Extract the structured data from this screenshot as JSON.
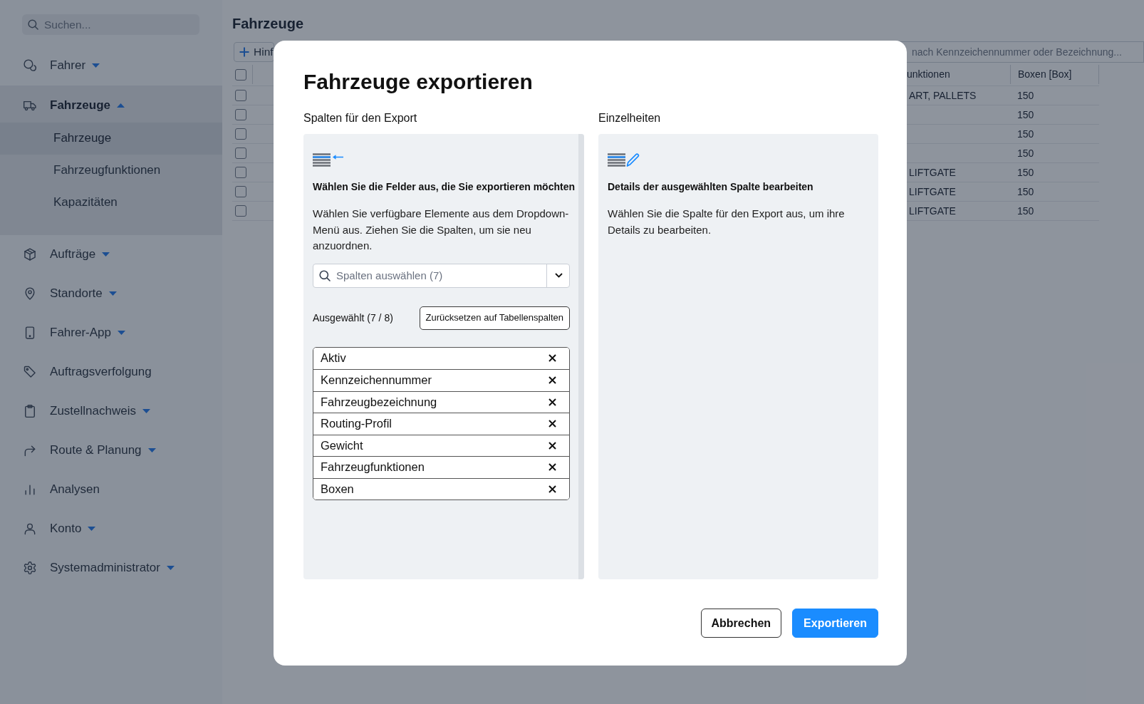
{
  "sidebar": {
    "search": {
      "placeholder": "Suchen..."
    },
    "items": [
      {
        "label": "Fahrer",
        "kind": "group",
        "expanded": false
      },
      {
        "label": "Fahrzeuge",
        "kind": "group",
        "expanded": true,
        "children": [
          {
            "label": "Fahrzeuge",
            "selected": true
          },
          {
            "label": "Fahrzeugfunktionen",
            "selected": false
          },
          {
            "label": "Kapazitäten",
            "selected": false
          }
        ]
      },
      {
        "label": "Aufträge",
        "kind": "group",
        "expanded": false
      },
      {
        "label": "Standorte",
        "kind": "group",
        "expanded": false
      },
      {
        "label": "Fahrer-App",
        "kind": "group",
        "expanded": false
      },
      {
        "label": "Auftragsverfolgung",
        "kind": "link"
      },
      {
        "label": "Zustellnachweis",
        "kind": "group",
        "expanded": false
      },
      {
        "label": "Route & Planung",
        "kind": "group",
        "expanded": false
      },
      {
        "label": "Analysen",
        "kind": "link"
      },
      {
        "label": "Konto",
        "kind": "group",
        "expanded": false
      },
      {
        "label": "Systemadministrator",
        "kind": "group",
        "expanded": false
      }
    ]
  },
  "page": {
    "title": "Fahrzeuge",
    "add_button": {
      "label": "Hinf"
    },
    "search": {
      "placeholder": "nach Kennzeichennummer oder Bezeichnung..."
    },
    "table": {
      "select_all": {
        "checked": false
      },
      "columns": [
        "unktionen",
        "Boxen [Box]"
      ],
      "rows": [
        {
          "checked": false,
          "column_1": "ART, PALLETS",
          "column_2": "150"
        },
        {
          "checked": false,
          "column_2": "150"
        },
        {
          "checked": false,
          "column_2": "150"
        },
        {
          "checked": false,
          "column_2": "150"
        },
        {
          "checked": false,
          "column_1": "LIFTGATE",
          "column_2": "150"
        },
        {
          "checked": false,
          "column_1": "LIFTGATE",
          "column_2": "150"
        },
        {
          "checked": false,
          "column_1": "LIFTGATE",
          "column_2": "150"
        }
      ]
    }
  },
  "dialog": {
    "title": "Fahrzeuge exportieren",
    "columns_panel": {
      "heading": "Spalten für den Export",
      "title": "Wählen Sie die Felder aus, die Sie exportieren möchten",
      "description": "Wählen Sie verfügbare Elemente aus dem Dropdown-Menü aus. Ziehen Sie die Spalten, um sie neu anzuordnen.",
      "select": {
        "placeholder": "Spalten auswählen (7)"
      },
      "selected_count": "Ausgewählt (7 / 8)",
      "reset_button": "Zurücksetzen auf Tabellenspalten",
      "selected_columns": [
        "Aktiv",
        "Kennzeichennummer",
        "Fahrzeugbezeichnung",
        "Routing-Profil",
        "Gewicht",
        "Fahrzeugfunktionen",
        "Boxen"
      ]
    },
    "details_panel": {
      "heading": "Einzelheiten",
      "title": "Details der ausgewählten Spalte bearbeiten",
      "description": "Wählen Sie die Spalte für den Export aus, um ihre Details zu bearbeiten."
    },
    "buttons": [
      {
        "label": "Abbrechen",
        "kind": "secondary"
      },
      {
        "label": "Exportieren",
        "kind": "primary"
      }
    ]
  }
}
